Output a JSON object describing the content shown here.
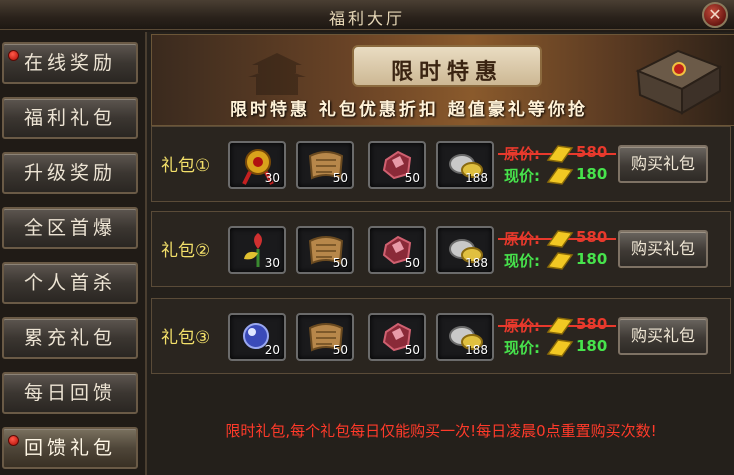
{
  "window": {
    "title": "福利大厅",
    "close_icon": "close-icon"
  },
  "sidebar": {
    "items": [
      {
        "label": "在线奖励",
        "dot": true
      },
      {
        "label": "福利礼包",
        "dot": false
      },
      {
        "label": "升级奖励",
        "dot": false
      },
      {
        "label": "全区首爆",
        "dot": false
      },
      {
        "label": "个人首杀",
        "dot": false
      },
      {
        "label": "累充礼包",
        "dot": false
      },
      {
        "label": "每日回馈",
        "dot": false
      },
      {
        "label": "回馈礼包",
        "dot": true
      }
    ]
  },
  "banner": {
    "title": "限时特惠",
    "subtitle": "限时特惠 礼包优惠折扣 超值豪礼等你抢"
  },
  "packs": [
    {
      "label": "礼包①",
      "items": [
        {
          "icon": "golden-amulet-icon",
          "qty": "30"
        },
        {
          "icon": "scroll-icon",
          "qty": "50"
        },
        {
          "icon": "red-gem-icon",
          "qty": "50"
        },
        {
          "icon": "silver-ingot-icon",
          "qty": "188"
        }
      ],
      "original_label": "原价:",
      "original_price": "580",
      "current_label": "现价:",
      "current_price": "180",
      "buy_label": "购买礼包"
    },
    {
      "label": "礼包②",
      "items": [
        {
          "icon": "flower-feather-icon",
          "qty": "30"
        },
        {
          "icon": "scroll-icon",
          "qty": "50"
        },
        {
          "icon": "red-gem-icon",
          "qty": "50"
        },
        {
          "icon": "silver-ingot-icon",
          "qty": "188"
        }
      ],
      "original_label": "原价:",
      "original_price": "580",
      "current_label": "现价:",
      "current_price": "180",
      "buy_label": "购买礼包"
    },
    {
      "label": "礼包③",
      "items": [
        {
          "icon": "blue-orb-icon",
          "qty": "20"
        },
        {
          "icon": "scroll-icon",
          "qty": "50"
        },
        {
          "icon": "red-gem-icon",
          "qty": "50"
        },
        {
          "icon": "silver-ingot-icon",
          "qty": "188"
        }
      ],
      "original_label": "原价:",
      "original_price": "580",
      "current_label": "现价:",
      "current_price": "180",
      "buy_label": "购买礼包"
    }
  ],
  "notice": "限时礼包,每个礼包每日仅能购买一次!每日凌晨0点重置购买次数!",
  "colors": {
    "original": "#e8392c",
    "current": "#47e34c",
    "pack_label": "#f3e06a",
    "notice": "#ff3a2a"
  }
}
